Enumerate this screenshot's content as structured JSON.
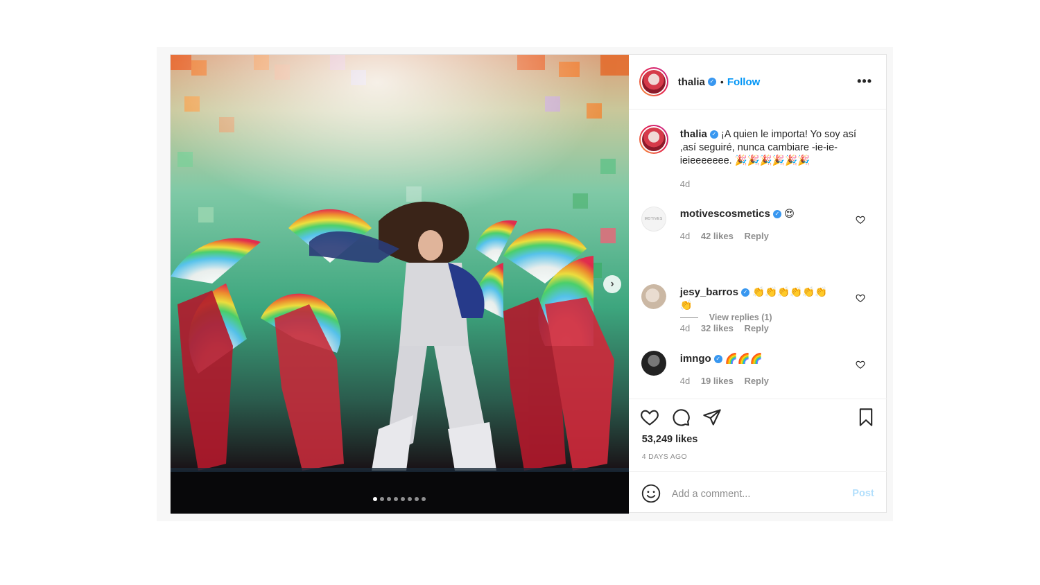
{
  "post": {
    "author": {
      "username": "thalia",
      "verified": true,
      "verified_glyph": "✓",
      "separator": "•",
      "follow_label": "Follow"
    },
    "more_icon": "more-horizontal-icon",
    "more_label": "•••",
    "photo": {
      "description_icon": "concert-photo",
      "next_label": "›",
      "carousel_total": 8,
      "carousel_active": 1
    },
    "caption": {
      "username": "thalia",
      "text": "¡A quien le importa! Yo soy así ,así seguiré, nunca cambiare -ie-ie-ieieeeeeee. 🎉🎉🎉🎉🎉🎉",
      "time": "4d"
    },
    "comments": [
      {
        "username": "motivescosmetics",
        "text": "😍",
        "time": "4d",
        "likes": "42 likes",
        "reply": "Reply",
        "avatar_label": "MOTIVES"
      },
      {
        "username": "jesy_barros",
        "text": "👏👏👏👏👏👏👏",
        "time": "4d",
        "likes": "32 likes",
        "reply": "Reply"
      },
      {
        "username": "imngo",
        "text": "🌈🌈🌈",
        "time": "4d",
        "likes": "19 likes",
        "reply": "Reply"
      }
    ],
    "view_replies_label": "View replies (1)",
    "likes_label": "53,249 likes",
    "time_ago": "4 DAYS AGO",
    "add_comment_placeholder": "Add a comment...",
    "post_button": "Post"
  },
  "colors": {
    "follow": "#0095f6",
    "post_button_disabled": "#b2dffc",
    "verified": "#3897f0"
  }
}
